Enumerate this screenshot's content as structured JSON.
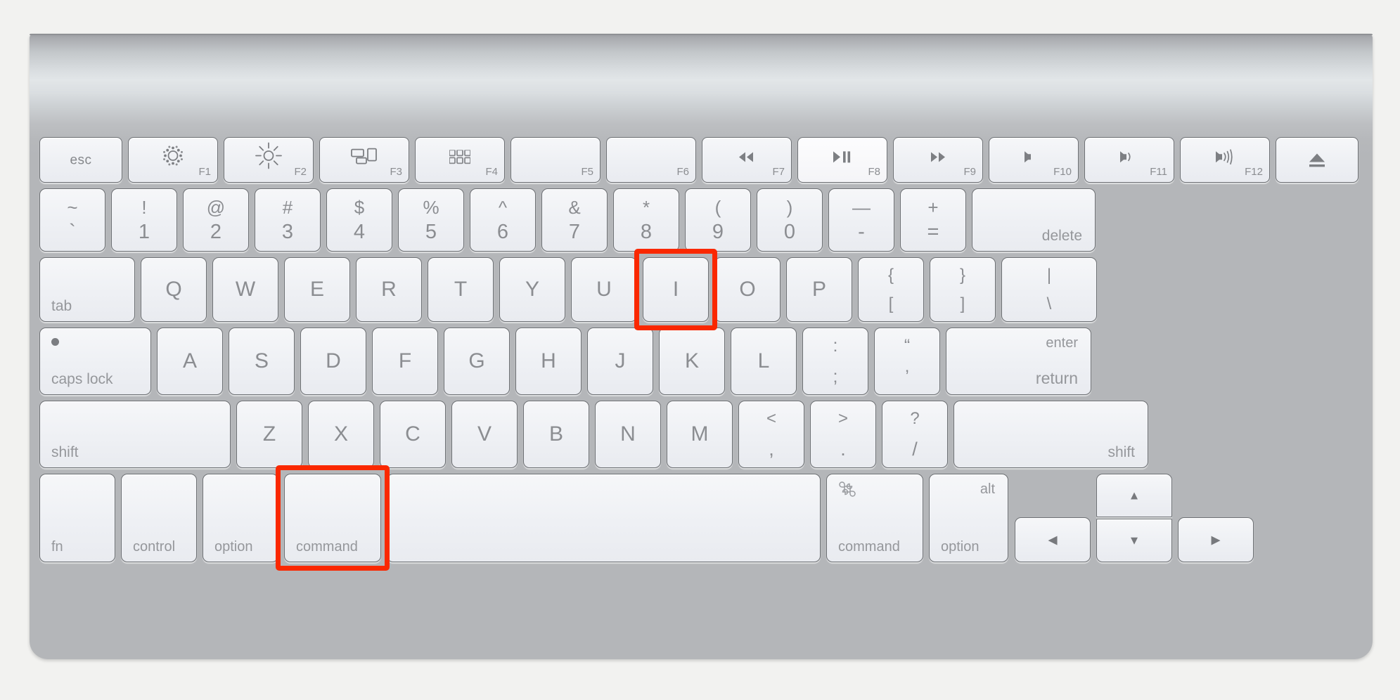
{
  "device": {
    "name": "apple-wireless-keyboard",
    "layout": "us-ansi-compact",
    "body_color": "#b4b6b9",
    "key_color": "#eef0f4",
    "label_color": "#8b8d91",
    "highlight_color": "#fa2800"
  },
  "highlights": [
    {
      "key": "I",
      "label": "I",
      "row": "qwerty"
    },
    {
      "key": "command-left",
      "label": "command",
      "row": "modifier"
    }
  ],
  "rows": {
    "function": [
      {
        "name": "esc",
        "label": "esc",
        "style": "word-center"
      },
      {
        "name": "f1",
        "label": "F1",
        "glyph": "brightness-down-icon",
        "glyph_char": "☀"
      },
      {
        "name": "f2",
        "label": "F2",
        "glyph": "brightness-up-icon",
        "glyph_char": "☀"
      },
      {
        "name": "f3",
        "label": "F3",
        "glyph": "mission-control-icon",
        "glyph_char": ""
      },
      {
        "name": "f4",
        "label": "F4",
        "glyph": "launchpad-icon",
        "glyph_char": ""
      },
      {
        "name": "f5",
        "label": "F5",
        "glyph": "",
        "glyph_char": ""
      },
      {
        "name": "f6",
        "label": "F6",
        "glyph": "",
        "glyph_char": ""
      },
      {
        "name": "f7",
        "label": "F7",
        "glyph": "rewind-icon",
        "glyph_char": "◀◀"
      },
      {
        "name": "f8",
        "label": "F8",
        "glyph": "play-pause-icon",
        "glyph_char": "▶❙❙",
        "lit": true
      },
      {
        "name": "f9",
        "label": "F9",
        "glyph": "fast-forward-icon",
        "glyph_char": "▶▶"
      },
      {
        "name": "f10",
        "label": "F10",
        "glyph": "mute-icon",
        "glyph_char": "◀"
      },
      {
        "name": "f11",
        "label": "F11",
        "glyph": "volume-down-icon",
        "glyph_char": "◀)"
      },
      {
        "name": "f12",
        "label": "F12",
        "glyph": "volume-up-icon",
        "glyph_char": "◀)))"
      },
      {
        "name": "eject",
        "label": "",
        "glyph": "eject-icon",
        "glyph_char": "⏏"
      }
    ],
    "number": [
      {
        "name": "tilde",
        "upper": "~",
        "lower": "`"
      },
      {
        "name": "1",
        "upper": "!",
        "lower": "1"
      },
      {
        "name": "2",
        "upper": "@",
        "lower": "2"
      },
      {
        "name": "3",
        "upper": "#",
        "lower": "3"
      },
      {
        "name": "4",
        "upper": "$",
        "lower": "4"
      },
      {
        "name": "5",
        "upper": "%",
        "lower": "5"
      },
      {
        "name": "6",
        "upper": "^",
        "lower": "6"
      },
      {
        "name": "7",
        "upper": "&",
        "lower": "7"
      },
      {
        "name": "8",
        "upper": "*",
        "lower": "8"
      },
      {
        "name": "9",
        "upper": "(",
        "lower": "9"
      },
      {
        "name": "0",
        "upper": ")",
        "lower": "0"
      },
      {
        "name": "minus",
        "upper": "—",
        "lower": "-"
      },
      {
        "name": "equal",
        "upper": "+",
        "lower": "="
      },
      {
        "name": "delete",
        "label": "delete",
        "align": "bottom-right"
      }
    ],
    "qwerty": [
      {
        "name": "tab",
        "label": "tab",
        "align": "bottom-left"
      },
      {
        "name": "Q",
        "label": "Q"
      },
      {
        "name": "W",
        "label": "W"
      },
      {
        "name": "E",
        "label": "E"
      },
      {
        "name": "R",
        "label": "R"
      },
      {
        "name": "T",
        "label": "T"
      },
      {
        "name": "Y",
        "label": "Y"
      },
      {
        "name": "U",
        "label": "U"
      },
      {
        "name": "I",
        "label": "I"
      },
      {
        "name": "O",
        "label": "O"
      },
      {
        "name": "P",
        "label": "P"
      },
      {
        "name": "bracket-left",
        "upper": "{",
        "lower": "["
      },
      {
        "name": "bracket-right",
        "upper": "}",
        "lower": "]"
      },
      {
        "name": "backslash",
        "upper": "|",
        "lower": "\\"
      }
    ],
    "home": [
      {
        "name": "caps-lock",
        "label": "caps lock",
        "align": "bottom-left",
        "led": true
      },
      {
        "name": "A",
        "label": "A"
      },
      {
        "name": "S",
        "label": "S"
      },
      {
        "name": "D",
        "label": "D"
      },
      {
        "name": "F",
        "label": "F"
      },
      {
        "name": "G",
        "label": "G"
      },
      {
        "name": "H",
        "label": "H"
      },
      {
        "name": "J",
        "label": "J"
      },
      {
        "name": "K",
        "label": "K"
      },
      {
        "name": "L",
        "label": "L"
      },
      {
        "name": "semicolon",
        "upper": ":",
        "lower": ";"
      },
      {
        "name": "quote",
        "upper": "“",
        "lower": "’"
      },
      {
        "name": "return",
        "upper_word": "enter",
        "lower_word": "return",
        "align": "right"
      }
    ],
    "shift": [
      {
        "name": "shift-left",
        "label": "shift",
        "align": "bottom-left"
      },
      {
        "name": "Z",
        "label": "Z"
      },
      {
        "name": "X",
        "label": "X"
      },
      {
        "name": "C",
        "label": "C"
      },
      {
        "name": "V",
        "label": "V"
      },
      {
        "name": "B",
        "label": "B"
      },
      {
        "name": "N",
        "label": "N"
      },
      {
        "name": "M",
        "label": "M"
      },
      {
        "name": "comma",
        "upper": "<",
        "lower": ","
      },
      {
        "name": "period",
        "upper": ">",
        "lower": "."
      },
      {
        "name": "slash",
        "upper": "?",
        "lower": "/"
      },
      {
        "name": "shift-right",
        "label": "shift",
        "align": "bottom-right"
      }
    ],
    "modifier": [
      {
        "name": "fn",
        "label": "fn",
        "align": "bottom-left"
      },
      {
        "name": "control",
        "label": "control",
        "align": "bottom-left"
      },
      {
        "name": "option-left",
        "label": "option",
        "align": "bottom-left"
      },
      {
        "name": "command-left",
        "label": "command",
        "align": "bottom-left"
      },
      {
        "name": "space",
        "label": "",
        "align": "none"
      },
      {
        "name": "command-right",
        "label": "command",
        "glyph_char": "⌘",
        "align": "bottom-left",
        "glyph_pos": "top-left"
      },
      {
        "name": "option-right",
        "label": "option",
        "alt_label": "alt",
        "align": "bottom-left",
        "glyph_pos": "top-right"
      },
      {
        "name": "arrow-left",
        "label": "◀"
      },
      {
        "name": "arrow-up",
        "label": "▲"
      },
      {
        "name": "arrow-down",
        "label": "▼"
      },
      {
        "name": "arrow-right",
        "label": "▶"
      }
    ]
  }
}
